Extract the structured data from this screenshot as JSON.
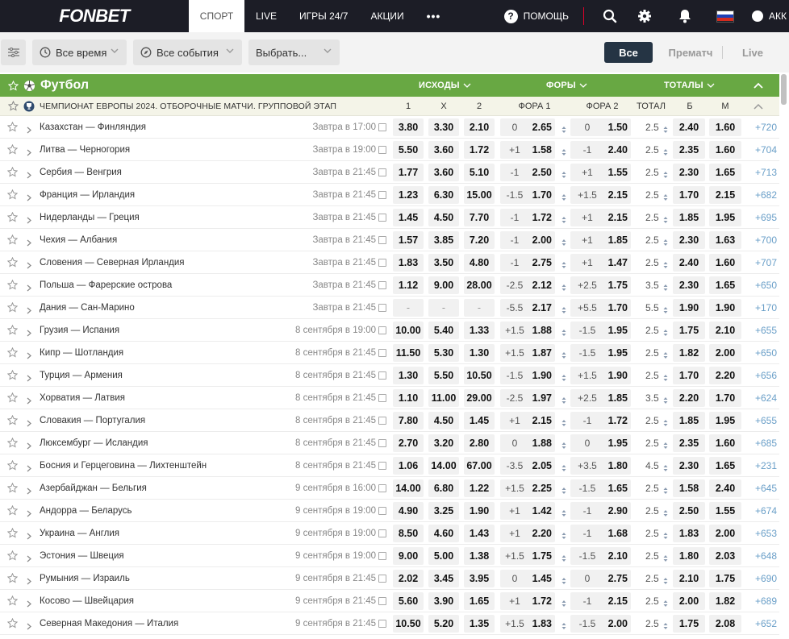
{
  "nav": {
    "logo": "FONBET",
    "items": [
      "СПОРТ",
      "LIVE",
      "ИГРЫ 24/7",
      "АКЦИИ",
      "•••"
    ],
    "help": "ПОМОЩЬ",
    "account": "АКК"
  },
  "filters": {
    "time": "Все время",
    "events": "Все события",
    "choose": "Выбрать...",
    "modes": [
      "Все",
      "Прематч",
      "Live"
    ]
  },
  "sport": {
    "title": "Футбол",
    "headers": [
      "ИСХОДЫ",
      "ФОРЫ",
      "ТОТАЛЫ"
    ]
  },
  "league": {
    "title": "ЧЕМПИОНАТ ЕВРОПЫ 2024. ОТБОРОЧНЫЕ МАТЧИ. ГРУППОВОЙ ЭТАП",
    "cols": [
      "1",
      "X",
      "2",
      "ФОРА 1",
      "ФОРА 2",
      "ТОТАЛ",
      "Б",
      "М"
    ]
  },
  "matches": [
    {
      "name": "Казахстан — Финляндия",
      "date": "Завтра в 17:00",
      "o1": "3.80",
      "ox": "3.30",
      "o2": "2.10",
      "f1h": "0",
      "f1": "2.65",
      "f2h": "0",
      "f2": "1.50",
      "tot": "2.5",
      "b": "2.40",
      "m": "1.60",
      "more": "+720"
    },
    {
      "name": "Литва — Черногория",
      "date": "Завтра в 19:00",
      "o1": "5.50",
      "ox": "3.60",
      "o2": "1.72",
      "f1h": "+1",
      "f1": "1.58",
      "f2h": "-1",
      "f2": "2.40",
      "tot": "2.5",
      "b": "2.35",
      "m": "1.60",
      "more": "+704"
    },
    {
      "name": "Сербия — Венгрия",
      "date": "Завтра в 21:45",
      "o1": "1.77",
      "ox": "3.60",
      "o2": "5.10",
      "f1h": "-1",
      "f1": "2.50",
      "f2h": "+1",
      "f2": "1.55",
      "tot": "2.5",
      "b": "2.30",
      "m": "1.65",
      "more": "+713"
    },
    {
      "name": "Франция — Ирландия",
      "date": "Завтра в 21:45",
      "o1": "1.23",
      "ox": "6.30",
      "o2": "15.00",
      "f1h": "-1.5",
      "f1": "1.70",
      "f2h": "+1.5",
      "f2": "2.15",
      "tot": "2.5",
      "b": "1.70",
      "m": "2.15",
      "more": "+682"
    },
    {
      "name": "Нидерланды — Греция",
      "date": "Завтра в 21:45",
      "o1": "1.45",
      "ox": "4.50",
      "o2": "7.70",
      "f1h": "-1",
      "f1": "1.72",
      "f2h": "+1",
      "f2": "2.15",
      "tot": "2.5",
      "b": "1.85",
      "m": "1.95",
      "more": "+695"
    },
    {
      "name": "Чехия — Албания",
      "date": "Завтра в 21:45",
      "o1": "1.57",
      "ox": "3.85",
      "o2": "7.20",
      "f1h": "-1",
      "f1": "2.00",
      "f2h": "+1",
      "f2": "1.85",
      "tot": "2.5",
      "b": "2.30",
      "m": "1.63",
      "more": "+700"
    },
    {
      "name": "Словения — Северная Ирландия",
      "date": "Завтра в 21:45",
      "o1": "1.83",
      "ox": "3.50",
      "o2": "4.80",
      "f1h": "-1",
      "f1": "2.75",
      "f2h": "+1",
      "f2": "1.47",
      "tot": "2.5",
      "b": "2.40",
      "m": "1.60",
      "more": "+707"
    },
    {
      "name": "Польша — Фарерские острова",
      "date": "Завтра в 21:45",
      "o1": "1.12",
      "ox": "9.00",
      "o2": "28.00",
      "f1h": "-2.5",
      "f1": "2.12",
      "f2h": "+2.5",
      "f2": "1.75",
      "tot": "3.5",
      "b": "2.30",
      "m": "1.65",
      "more": "+650"
    },
    {
      "name": "Дания — Сан-Марино",
      "date": "Завтра в 21:45",
      "o1": "-",
      "ox": "-",
      "o2": "-",
      "f1h": "-5.5",
      "f1": "2.17",
      "f2h": "+5.5",
      "f2": "1.70",
      "tot": "5.5",
      "b": "1.90",
      "m": "1.90",
      "more": "+170"
    },
    {
      "name": "Грузия — Испания",
      "date": "8 сентября в 19:00",
      "o1": "10.00",
      "ox": "5.40",
      "o2": "1.33",
      "f1h": "+1.5",
      "f1": "1.88",
      "f2h": "-1.5",
      "f2": "1.95",
      "tot": "2.5",
      "b": "1.75",
      "m": "2.10",
      "more": "+655"
    },
    {
      "name": "Кипр — Шотландия",
      "date": "8 сентября в 21:45",
      "o1": "11.50",
      "ox": "5.30",
      "o2": "1.30",
      "f1h": "+1.5",
      "f1": "1.87",
      "f2h": "-1.5",
      "f2": "1.95",
      "tot": "2.5",
      "b": "1.82",
      "m": "2.00",
      "more": "+650"
    },
    {
      "name": "Турция — Армения",
      "date": "8 сентября в 21:45",
      "o1": "1.30",
      "ox": "5.50",
      "o2": "10.50",
      "f1h": "-1.5",
      "f1": "1.90",
      "f2h": "+1.5",
      "f2": "1.90",
      "tot": "2.5",
      "b": "1.70",
      "m": "2.20",
      "more": "+656"
    },
    {
      "name": "Хорватия — Латвия",
      "date": "8 сентября в 21:45",
      "o1": "1.10",
      "ox": "11.00",
      "o2": "29.00",
      "f1h": "-2.5",
      "f1": "1.97",
      "f2h": "+2.5",
      "f2": "1.85",
      "tot": "3.5",
      "b": "2.20",
      "m": "1.70",
      "more": "+624"
    },
    {
      "name": "Словакия — Португалия",
      "date": "8 сентября в 21:45",
      "o1": "7.80",
      "ox": "4.50",
      "o2": "1.45",
      "f1h": "+1",
      "f1": "2.15",
      "f2h": "-1",
      "f2": "1.72",
      "tot": "2.5",
      "b": "1.85",
      "m": "1.95",
      "more": "+655"
    },
    {
      "name": "Люксембург — Исландия",
      "date": "8 сентября в 21:45",
      "o1": "2.70",
      "ox": "3.20",
      "o2": "2.80",
      "f1h": "0",
      "f1": "1.88",
      "f2h": "0",
      "f2": "1.95",
      "tot": "2.5",
      "b": "2.35",
      "m": "1.60",
      "more": "+685"
    },
    {
      "name": "Босния и Герцеговина — Лихтенштейн",
      "date": "8 сентября в 21:45",
      "o1": "1.06",
      "ox": "14.00",
      "o2": "67.00",
      "f1h": "-3.5",
      "f1": "2.05",
      "f2h": "+3.5",
      "f2": "1.80",
      "tot": "4.5",
      "b": "2.30",
      "m": "1.65",
      "more": "+231"
    },
    {
      "name": "Азербайджан — Бельгия",
      "date": "9 сентября в 16:00",
      "o1": "14.00",
      "ox": "6.80",
      "o2": "1.22",
      "f1h": "+1.5",
      "f1": "2.25",
      "f2h": "-1.5",
      "f2": "1.65",
      "tot": "2.5",
      "b": "1.58",
      "m": "2.40",
      "more": "+645"
    },
    {
      "name": "Андорра — Беларусь",
      "date": "9 сентября в 19:00",
      "o1": "4.90",
      "ox": "3.25",
      "o2": "1.90",
      "f1h": "+1",
      "f1": "1.42",
      "f2h": "-1",
      "f2": "2.90",
      "tot": "2.5",
      "b": "2.50",
      "m": "1.55",
      "more": "+674"
    },
    {
      "name": "Украина — Англия",
      "date": "9 сентября в 19:00",
      "o1": "8.50",
      "ox": "4.60",
      "o2": "1.43",
      "f1h": "+1",
      "f1": "2.20",
      "f2h": "-1",
      "f2": "1.68",
      "tot": "2.5",
      "b": "1.83",
      "m": "2.00",
      "more": "+653"
    },
    {
      "name": "Эстония — Швеция",
      "date": "9 сентября в 19:00",
      "o1": "9.00",
      "ox": "5.00",
      "o2": "1.38",
      "f1h": "+1.5",
      "f1": "1.75",
      "f2h": "-1.5",
      "f2": "2.10",
      "tot": "2.5",
      "b": "1.80",
      "m": "2.03",
      "more": "+648"
    },
    {
      "name": "Румыния — Израиль",
      "date": "9 сентября в 21:45",
      "o1": "2.02",
      "ox": "3.45",
      "o2": "3.95",
      "f1h": "0",
      "f1": "1.45",
      "f2h": "0",
      "f2": "2.75",
      "tot": "2.5",
      "b": "2.10",
      "m": "1.75",
      "more": "+690"
    },
    {
      "name": "Косово — Швейцария",
      "date": "9 сентября в 21:45",
      "o1": "5.60",
      "ox": "3.90",
      "o2": "1.65",
      "f1h": "+1",
      "f1": "1.72",
      "f2h": "-1",
      "f2": "2.15",
      "tot": "2.5",
      "b": "2.00",
      "m": "1.82",
      "more": "+689"
    },
    {
      "name": "Северная Македония — Италия",
      "date": "9 сентября в 21:45",
      "o1": "10.50",
      "ox": "5.20",
      "o2": "1.35",
      "f1h": "+1.5",
      "f1": "1.83",
      "f2h": "-1.5",
      "f2": "2.00",
      "tot": "2.5",
      "b": "1.75",
      "m": "2.08",
      "more": "+652"
    }
  ]
}
